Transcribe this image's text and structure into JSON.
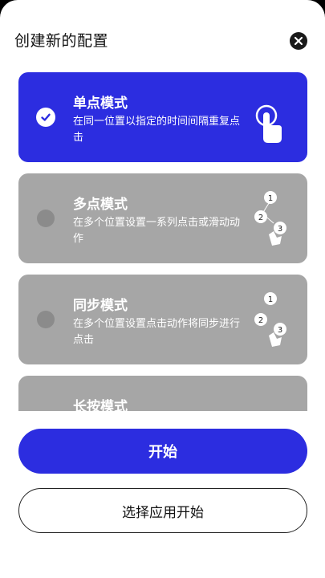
{
  "header": {
    "title": "创建新的配置",
    "close_icon": "close-icon"
  },
  "modes": [
    {
      "title": "单点模式",
      "desc": "在同一位置以指定的时间间隔重复点击",
      "selected": true,
      "icon": "single-tap-icon"
    },
    {
      "title": "多点模式",
      "desc": "在多个位置设置一系列点击或滑动动作",
      "selected": false,
      "icon": "multi-tap-icon",
      "icon_labels": [
        "1",
        "2",
        "3"
      ]
    },
    {
      "title": "同步模式",
      "desc": "在多个位置设置点击动作将同步进行点击",
      "selected": false,
      "icon": "sync-tap-icon",
      "icon_labels": [
        "1",
        "2",
        "3"
      ]
    },
    {
      "title": "长按模式",
      "desc": "",
      "selected": false,
      "icon": "long-press-icon"
    }
  ],
  "actions": {
    "start_label": "开始",
    "choose_app_label": "选择应用开始"
  },
  "colors": {
    "accent": "#2c2de0",
    "card_inactive": "#a6a6a6",
    "radio_inactive": "#8b8b8b"
  }
}
